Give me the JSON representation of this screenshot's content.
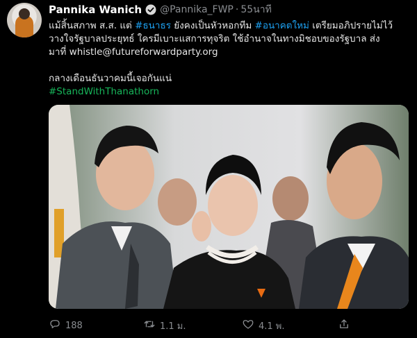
{
  "tweet": {
    "author": {
      "name": "Pannika Wanich",
      "handle": "@Pannika_FWP",
      "time": "55นาที",
      "separator": "·"
    },
    "text": {
      "l1_a": "แม้สิ้นสภาพ ส.ส. แต่ ",
      "l1_tag1": "#ธนาธร",
      "l1_b": " ยังคงเป็นหัวหอกทีม ",
      "l1_tag2": "#อนาคตใหม่",
      "l1_c": " เตรียมอภิปรายไม่ไว้",
      "l2": "วางใจรัฐบาลประยุทธ์ ใครมีเบาะแสการทุจริต ใช้อำนาจในทางมิชอบของรัฐบาล ส่ง",
      "l3": "มาที่ whistle@futureforwardparty.org",
      "l4": "กลางเดือนธันวาคมนี้เจอกันแน่",
      "hashtag": "#StandWithThanathorn"
    },
    "actions": {
      "reply_count": "188",
      "retweet_count": "1.1 ม.",
      "like_count": "4.1 พ."
    }
  },
  "colors": {
    "background": "#000000",
    "link_blue": "#1da1f2",
    "hashtag_green": "#17b55a",
    "muted": "#8a8d91"
  },
  "icons": [
    "avatar",
    "verified-badge-icon",
    "reply-icon",
    "retweet-icon",
    "like-icon",
    "share-icon"
  ]
}
